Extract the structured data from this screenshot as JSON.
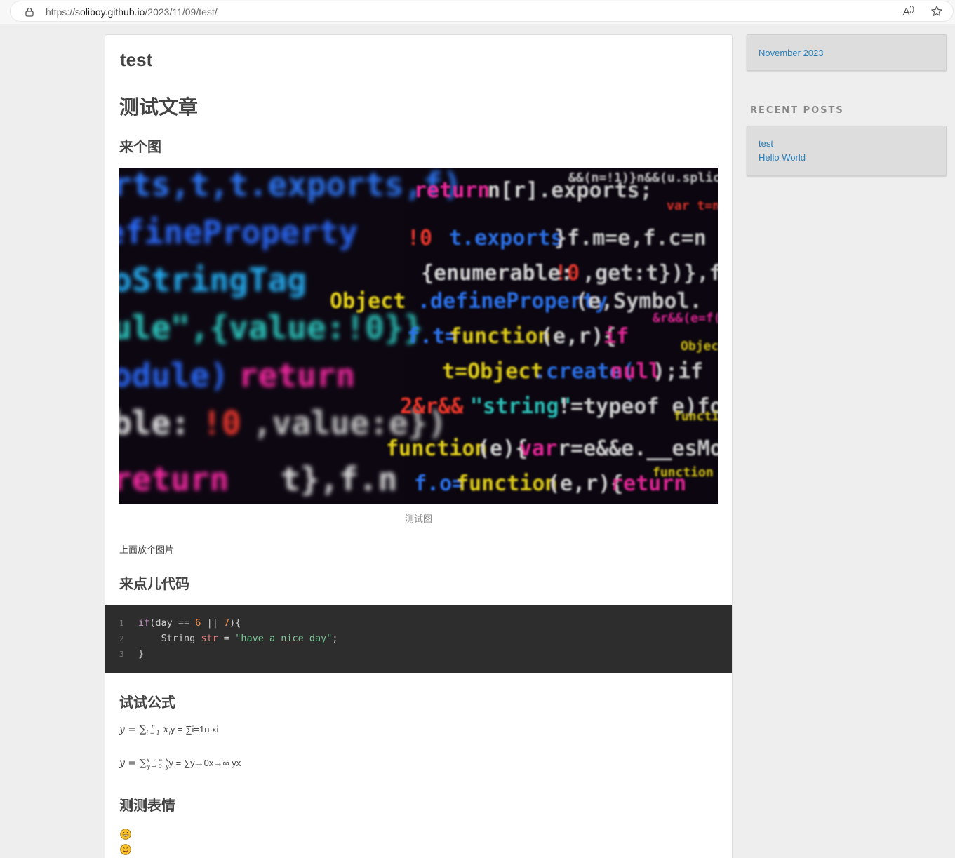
{
  "browser": {
    "url_prefix": "https://",
    "url_domain": "soliboy.github.io",
    "url_path": "/2023/11/09/test/",
    "read_aloud_label": "A))"
  },
  "article": {
    "title": "test",
    "heading_main": "测试文章",
    "heading_image": "来个图",
    "image_caption": "测试图",
    "text_after_image": "上面放个图片",
    "heading_code": "来点儿代码",
    "code": {
      "line_numbers": [
        "1",
        "2",
        "3"
      ],
      "line1": {
        "kw": "if",
        "p1": "(day == ",
        "n1": "6",
        "p2": " || ",
        "n2": "7",
        "p3": "){"
      },
      "line2": {
        "p1": "    String ",
        "var": "str",
        "p2": " = ",
        "str": "\"have a nice day\"",
        "p3": ";"
      },
      "line3": {
        "p1": "}"
      }
    },
    "heading_formula": "试试公式",
    "formula1": {
      "y": "y",
      "eq": " = ",
      "sum": "∑",
      "sub": "i = 1",
      "sup": "n",
      "term": "x",
      "term_sub": "i",
      "plain": "y = ∑i=1n xi"
    },
    "formula2": {
      "y": "y",
      "eq": " = ",
      "sum": "∑",
      "top": "x → ∞",
      "bottom": "y → 0",
      "num": "x",
      "den": "y",
      "plain": "y = ∑y→0x→∞ yx"
    },
    "heading_emoji": "测测表情",
    "emojis": [
      "grinning-face",
      "smiling-face-savoring"
    ]
  },
  "sidebar": {
    "archive_link": "November 2023",
    "recent_posts_title": "RECENT POSTS",
    "recent_posts": [
      "test",
      "Hello World"
    ]
  },
  "colors": {
    "link": "#2b7fb8",
    "code_bg": "#2d2d2d"
  }
}
